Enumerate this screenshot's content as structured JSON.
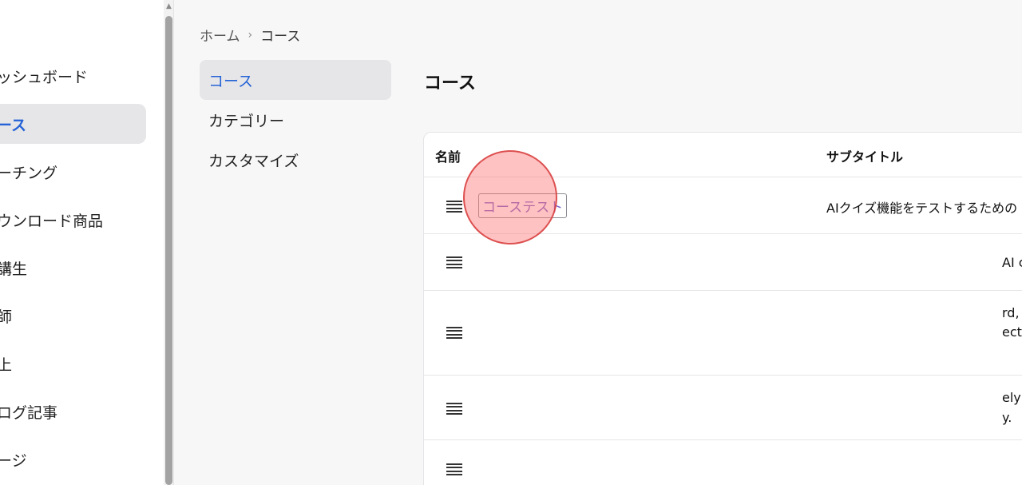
{
  "sidebar": {
    "items": [
      {
        "label": "ダッシュボード"
      },
      {
        "label": "コース"
      },
      {
        "label": "コーチング"
      },
      {
        "label": "ダウンロード商品"
      },
      {
        "label": "受講生"
      },
      {
        "label": "講師"
      },
      {
        "label": "売上"
      },
      {
        "label": "ブログ記事"
      },
      {
        "label": "ページ"
      }
    ],
    "visible_labels": [
      "ッシュボード",
      "ース",
      "ーチング",
      "ウンロード商品",
      "講生",
      "師",
      "上",
      "ログ記事",
      "ージ"
    ],
    "active_index": 1
  },
  "breadcrumb": {
    "home": "ホーム",
    "separator": "›",
    "current": "コース"
  },
  "subnav": {
    "items": [
      {
        "label": "コース"
      },
      {
        "label": "カテゴリー"
      },
      {
        "label": "カスタマイズ"
      }
    ],
    "active_index": 0
  },
  "page_title": "コース",
  "table": {
    "columns": {
      "name": "名前",
      "subtitle": "サブタイトル"
    },
    "rows": [
      {
        "name": "コーステスト",
        "subtitle_lines": [
          "AIクイズ機能をテストするための"
        ]
      },
      {
        "name": "",
        "subtitle_lines": [
          "AI c"
        ]
      },
      {
        "name": "",
        "subtitle_lines": [
          "rd, p",
          "ect"
        ]
      },
      {
        "name": "",
        "subtitle_lines": [
          "ely",
          "y."
        ]
      },
      {
        "name": "",
        "subtitle_lines": []
      }
    ]
  },
  "colors": {
    "accent": "#2563d6",
    "active_bg": "#e6e6e8",
    "link_text": "#7a5fc9",
    "click_indicator": "#ff7878"
  },
  "icons": {
    "drag_handle": "drag-handle-icon",
    "scroll_up": "scroll-up-arrow-icon",
    "breadcrumb_sep": "chevron-right-icon"
  }
}
